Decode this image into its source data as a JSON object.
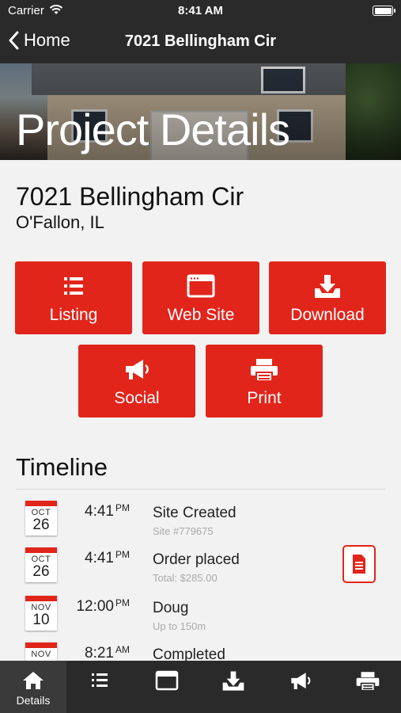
{
  "status_bar": {
    "carrier": "Carrier",
    "time": "8:41 AM"
  },
  "nav": {
    "back_label": "Home",
    "title": "7021 Bellingham Cir"
  },
  "hero": {
    "heading": "Project Details"
  },
  "property": {
    "address": "7021 Bellingham Cir",
    "city": "O'Fallon, IL"
  },
  "actions": [
    {
      "label": "Listing",
      "icon": "list-icon"
    },
    {
      "label": "Web Site",
      "icon": "browser-icon"
    },
    {
      "label": "Download",
      "icon": "download-icon"
    },
    {
      "label": "Social",
      "icon": "megaphone-icon"
    },
    {
      "label": "Print",
      "icon": "printer-icon"
    }
  ],
  "timeline": {
    "heading": "Timeline",
    "items": [
      {
        "month": "OCT",
        "day": "26",
        "time": "4:41",
        "ampm": "PM",
        "title": "Site Created",
        "subtitle": "Site #779675"
      },
      {
        "month": "OCT",
        "day": "26",
        "time": "4:41",
        "ampm": "PM",
        "title": "Order placed",
        "subtitle": "Total: $285.00"
      },
      {
        "month": "NOV",
        "day": "10",
        "time": "12:00",
        "ampm": "PM",
        "title": "Doug",
        "subtitle": "Up to 150m"
      },
      {
        "month": "NOV",
        "day": "",
        "time": "8:21",
        "ampm": "AM",
        "title": "Completed",
        "subtitle": ""
      }
    ]
  },
  "tabbar": {
    "details_label": "Details"
  },
  "colors": {
    "accent": "#e1251b",
    "bar": "#2a2a2a",
    "background": "#f2f2f2"
  }
}
